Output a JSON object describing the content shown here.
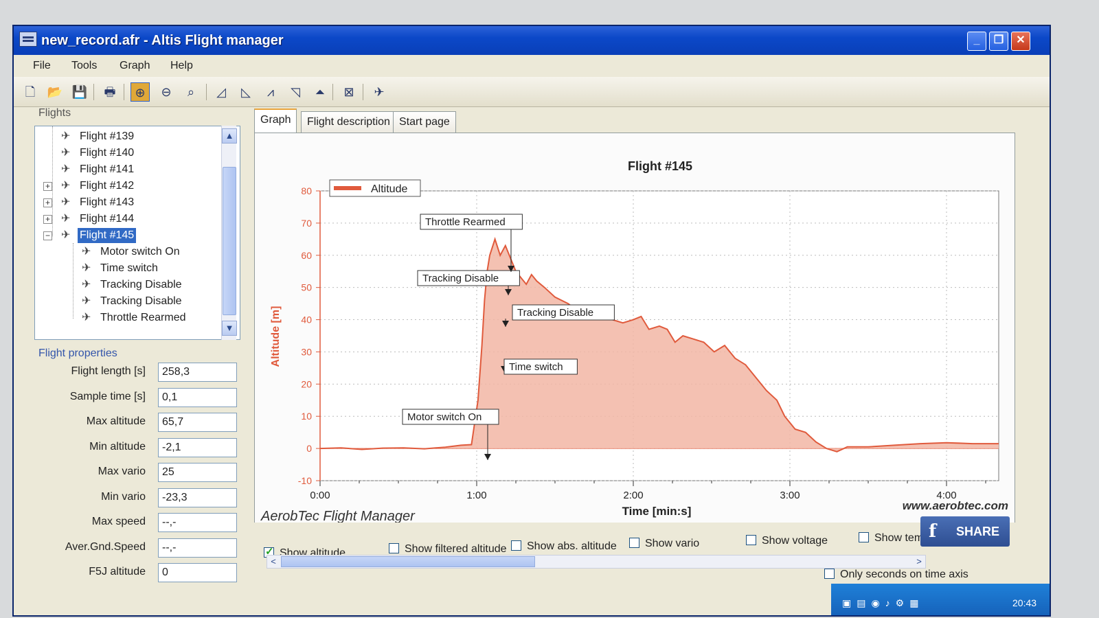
{
  "window": {
    "title": "new_record.afr - Altis Flight manager"
  },
  "menu": [
    "File",
    "Tools",
    "Graph",
    "Help"
  ],
  "toolbar": {
    "buttons": [
      {
        "icon": "new-file-icon",
        "glyph": "🗋"
      },
      {
        "icon": "open-folder-icon",
        "glyph": "📂"
      },
      {
        "icon": "save-icon",
        "glyph": "💾"
      },
      {
        "icon": "print-icon",
        "glyph": "🖶"
      },
      {
        "icon": "zoom-in-icon",
        "glyph": "⊕",
        "active": true
      },
      {
        "icon": "zoom-out-icon",
        "glyph": "⊖"
      },
      {
        "icon": "zoom-fit-icon",
        "glyph": "⌕"
      },
      {
        "icon": "graph-view-1-icon",
        "glyph": "◿"
      },
      {
        "icon": "graph-view-2-icon",
        "glyph": "◺"
      },
      {
        "icon": "graph-view-3-icon",
        "glyph": "⩘"
      },
      {
        "icon": "graph-view-4-icon",
        "glyph": "◹"
      },
      {
        "icon": "graph-view-5-icon",
        "glyph": "⏶"
      },
      {
        "icon": "clear-icon",
        "glyph": "⊠"
      },
      {
        "icon": "device-icon",
        "glyph": "✈"
      }
    ]
  },
  "flights": {
    "group_label": "Flights",
    "items": [
      {
        "label": "Flight #139",
        "level": 0,
        "expander": ""
      },
      {
        "label": "Flight #140",
        "level": 0,
        "expander": ""
      },
      {
        "label": "Flight #141",
        "level": 0,
        "expander": ""
      },
      {
        "label": "Flight #142",
        "level": 0,
        "expander": "+"
      },
      {
        "label": "Flight #143",
        "level": 0,
        "expander": "+"
      },
      {
        "label": "Flight #144",
        "level": 0,
        "expander": "+"
      },
      {
        "label": "Flight #145",
        "level": 0,
        "expander": "−",
        "selected": true
      },
      {
        "label": "Motor switch On",
        "level": 1,
        "expander": ""
      },
      {
        "label": "Time switch",
        "level": 1,
        "expander": ""
      },
      {
        "label": "Tracking Disable",
        "level": 1,
        "expander": ""
      },
      {
        "label": "Tracking Disable",
        "level": 1,
        "expander": ""
      },
      {
        "label": "Throttle Rearmed",
        "level": 1,
        "expander": ""
      }
    ]
  },
  "properties": {
    "title": "Flight properties",
    "rows": [
      {
        "label": "Flight length [s]",
        "value": "258,3"
      },
      {
        "label": "Sample time [s]",
        "value": "0,1"
      },
      {
        "label": "Max altitude",
        "value": "65,7"
      },
      {
        "label": "Min altitude",
        "value": "-2,1"
      },
      {
        "label": "Max vario",
        "value": "25"
      },
      {
        "label": "Min vario",
        "value": "-23,3"
      },
      {
        "label": "Max speed",
        "value": "--,-"
      },
      {
        "label": "Aver.Gnd.Speed",
        "value": "--,-"
      },
      {
        "label": "F5J altitude",
        "value": "0"
      }
    ]
  },
  "tabs": [
    {
      "label": "Graph",
      "active": true
    },
    {
      "label": "Flight description"
    },
    {
      "label": "Start page"
    }
  ],
  "chart_data": {
    "type": "area",
    "title": "Flight #145",
    "xlabel": "Time [min:s]",
    "ylabel": "Altitude [m]",
    "xlim": [
      0,
      260
    ],
    "ylim": [
      -10,
      80
    ],
    "x_ticks": [
      {
        "v": 0,
        "label": "0:00"
      },
      {
        "v": 60,
        "label": "1:00"
      },
      {
        "v": 120,
        "label": "2:00"
      },
      {
        "v": 180,
        "label": "3:00"
      },
      {
        "v": 240,
        "label": "4:00"
      }
    ],
    "y_ticks": [
      -10,
      0,
      10,
      20,
      30,
      40,
      50,
      60,
      70,
      80
    ],
    "grid": true,
    "legend": {
      "position": "top-left",
      "entries": [
        "Altitude"
      ]
    },
    "series": [
      {
        "name": "Altitude",
        "color": "#e05a3c",
        "points": [
          [
            0,
            0
          ],
          [
            8,
            0.2
          ],
          [
            16,
            -0.3
          ],
          [
            24,
            0.1
          ],
          [
            32,
            0.2
          ],
          [
            40,
            -0.1
          ],
          [
            48,
            0.4
          ],
          [
            54,
            1
          ],
          [
            58,
            1.2
          ],
          [
            60.5,
            15
          ],
          [
            62,
            32
          ],
          [
            63,
            46
          ],
          [
            64,
            55
          ],
          [
            65,
            60
          ],
          [
            67,
            65
          ],
          [
            69,
            60
          ],
          [
            71,
            63
          ],
          [
            73,
            59
          ],
          [
            75,
            55
          ],
          [
            77,
            53
          ],
          [
            79,
            51
          ],
          [
            81,
            54
          ],
          [
            83,
            52
          ],
          [
            86,
            50
          ],
          [
            90,
            47
          ],
          [
            95,
            45
          ],
          [
            100,
            42
          ],
          [
            104,
            41
          ],
          [
            108,
            42
          ],
          [
            112,
            40
          ],
          [
            116,
            39
          ],
          [
            120,
            40
          ],
          [
            123,
            41
          ],
          [
            126,
            37
          ],
          [
            130,
            38
          ],
          [
            133,
            37
          ],
          [
            136,
            33
          ],
          [
            139,
            35
          ],
          [
            143,
            34
          ],
          [
            147,
            33
          ],
          [
            151,
            30
          ],
          [
            155,
            32
          ],
          [
            159,
            28
          ],
          [
            163,
            26
          ],
          [
            167,
            22
          ],
          [
            171,
            18
          ],
          [
            175,
            15
          ],
          [
            178,
            10
          ],
          [
            182,
            6
          ],
          [
            186,
            5
          ],
          [
            190,
            2
          ],
          [
            194,
            0
          ],
          [
            198,
            -1
          ],
          [
            202,
            0.5
          ],
          [
            210,
            0.5
          ],
          [
            220,
            1
          ],
          [
            230,
            1.5
          ],
          [
            240,
            1.8
          ],
          [
            250,
            1.5
          ],
          [
            260,
            1.5
          ]
        ]
      }
    ],
    "event_labels": [
      {
        "text": "Motor switch On",
        "x": 60,
        "y": 0
      },
      {
        "text": "Time switch",
        "x": 61,
        "y": 25
      },
      {
        "text": "Tracking Disable",
        "x": 62,
        "y": 45
      },
      {
        "text": "Tracking Disable",
        "x": 62,
        "y": 58
      },
      {
        "text": "Throttle Rearmed",
        "x": 63,
        "y": 60
      }
    ],
    "watermark_left": "AerobTec Flight Manager",
    "watermark_right": "www.aerobtec.com"
  },
  "options": {
    "show_altitude": "Show altitude",
    "show_filtered": "Show filtered altitude",
    "show_abs": "Show abs. altitude",
    "show_vario": "Show vario",
    "show_voltage": "Show voltage",
    "show_temp": "Show tem",
    "only_seconds": "Only seconds on time axis"
  },
  "share": {
    "label": "SHARE"
  },
  "taskbar": {
    "clock": "20:43"
  }
}
